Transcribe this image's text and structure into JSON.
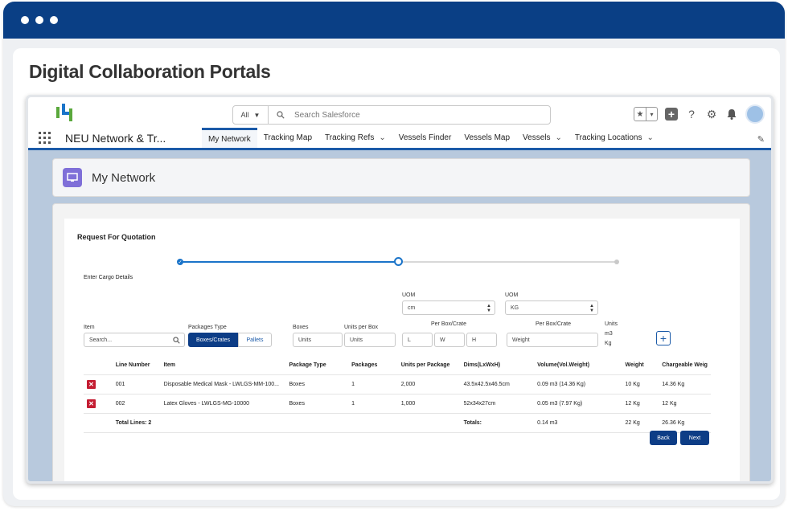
{
  "window": {
    "title": "Digital Collaboration Portals"
  },
  "header": {
    "search_scope": "All",
    "search_placeholder": "Search Salesforce"
  },
  "nav": {
    "app_name": "NEU Network & Tr...",
    "items": [
      {
        "label": "My Network",
        "active": true,
        "dropdown": false
      },
      {
        "label": "Tracking Map",
        "active": false,
        "dropdown": false
      },
      {
        "label": "Tracking Refs",
        "active": false,
        "dropdown": true
      },
      {
        "label": "Vessels Finder",
        "active": false,
        "dropdown": false
      },
      {
        "label": "Vessels Map",
        "active": false,
        "dropdown": false
      },
      {
        "label": "Vessels",
        "active": false,
        "dropdown": true
      },
      {
        "label": "Tracking Locations",
        "active": false,
        "dropdown": true
      }
    ]
  },
  "page": {
    "title": "My Network"
  },
  "form": {
    "title": "Request For Quotation",
    "step_label": "Enter Cargo Details",
    "item_label": "Item",
    "item_placeholder": "Search...",
    "packages_type_label": "Packages Type",
    "pkg_opt_boxes": "Boxes/Crates",
    "pkg_opt_pallets": "Pallets",
    "boxes_label": "Boxes",
    "boxes_placeholder": "Units",
    "units_per_box_label": "Units per Box",
    "units_per_box_placeholder": "Units",
    "uom_dims_label": "UOM",
    "uom_dims_value": "cm",
    "per_box_dims_label": "Per Box/Crate",
    "l_placeholder": "L",
    "w_placeholder": "W",
    "h_placeholder": "H",
    "uom_weight_label": "UOM",
    "uom_weight_value": "KG",
    "per_box_weight_label": "Per Box/Crate",
    "weight_placeholder": "Weight",
    "units_label": "Units",
    "units_m3": "m3",
    "units_kg": "Kg"
  },
  "table": {
    "headers": [
      "Line Number",
      "Item",
      "Package Type",
      "Packages",
      "Units per Package",
      "Dims(LxWxH)",
      "Volume(Vol.Weight)",
      "Weight",
      "Chargeable Weig"
    ],
    "rows": [
      [
        "001",
        "Disposable Medical Mask - LWLGS-MM-100...",
        "Boxes",
        "1",
        "2,000",
        "43.5x42.5x46.5cm",
        "0.09 m3 (14.36 Kg)",
        "10 Kg",
        "14.36 Kg"
      ],
      [
        "002",
        "Latex Gloves - LWLGS-MG-10000",
        "Boxes",
        "1",
        "1,000",
        "52x34x27cm",
        "0.05 m3 (7.97 Kg)",
        "12 Kg",
        "12 Kg"
      ]
    ],
    "total_lines": "Total Lines: 2",
    "totals_label": "Totals:",
    "total_volume": "0.14 m3",
    "total_weight": "22 Kg",
    "total_chargeable": "26.36 Kg"
  },
  "buttons": {
    "back": "Back",
    "next": "Next"
  },
  "colors": {
    "brand_blue": "#0a3f85",
    "button_blue": "#0d3d86",
    "delete_red": "#c41d32",
    "page_icon_purple": "#7f6fd8"
  }
}
